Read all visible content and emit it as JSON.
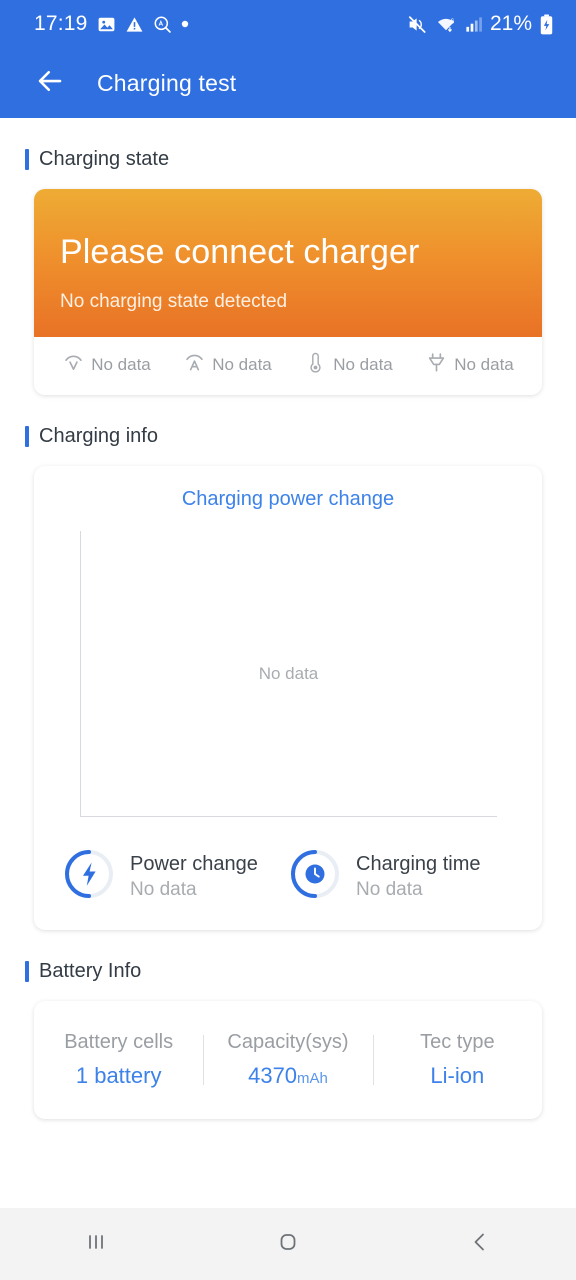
{
  "status_bar": {
    "time": "17:19",
    "battery_percent": "21%",
    "left_icons": [
      "image-icon",
      "warning-triangle-icon",
      "adaptive-search-icon",
      "dot-icon"
    ],
    "right_icons": [
      "mute-icon",
      "wifi-icon",
      "signal-bars-icon",
      "battery-charging-icon"
    ]
  },
  "app_bar": {
    "back_icon": "arrow-left-icon",
    "title": "Charging test",
    "background_color": "#2f6fe0"
  },
  "sections": {
    "charging_state": {
      "title": "Charging state",
      "banner": {
        "headline": "Please connect charger",
        "subtext": "No charging state detected",
        "gradient_from": "#eeac34",
        "gradient_to": "#e87226"
      },
      "stats": [
        {
          "icon": "voltage-icon",
          "label": "No data"
        },
        {
          "icon": "amperage-icon",
          "label": "No data"
        },
        {
          "icon": "thermometer-icon",
          "label": "No data"
        },
        {
          "icon": "plug-icon",
          "label": "No data"
        }
      ]
    },
    "charging_info": {
      "title": "Charging info",
      "chart_title": "Charging power change",
      "chart_empty_text": "No data",
      "metrics": [
        {
          "icon": "lightning-bolt-icon",
          "name": "Power change",
          "value": "No data"
        },
        {
          "icon": "clock-icon",
          "name": "Charging time",
          "value": "No data"
        }
      ]
    },
    "battery_info": {
      "title": "Battery Info",
      "cells": [
        {
          "label": "Battery cells",
          "value": "1 battery",
          "unit": ""
        },
        {
          "label": "Capacity(sys)",
          "value": "4370",
          "unit": "mAh"
        },
        {
          "label": "Tec type",
          "value": "Li-ion",
          "unit": ""
        }
      ]
    }
  },
  "nav_bar": {
    "recents_icon": "recents-icon",
    "home_icon": "home-icon",
    "back_icon": "back-chevron-icon"
  },
  "chart_data": {
    "type": "line",
    "title": "Charging power change",
    "series": [],
    "x": [],
    "values": [],
    "xlabel": "",
    "ylabel": "",
    "grid": false,
    "empty_state": "No data"
  }
}
